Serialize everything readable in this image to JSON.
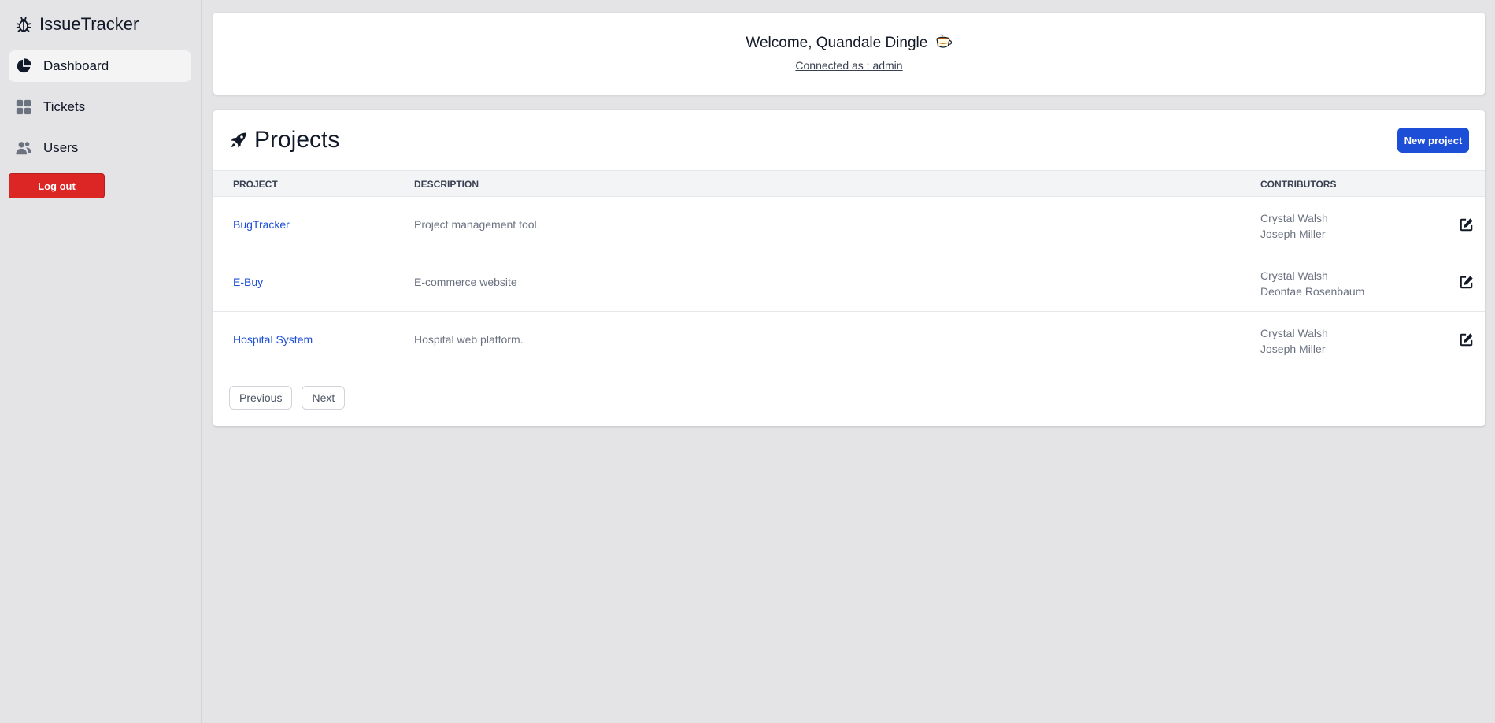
{
  "app": {
    "name": "IssueTracker",
    "logo_icon": "bug-icon"
  },
  "sidebar": {
    "items": [
      {
        "label": "Dashboard",
        "icon": "pie-chart-icon",
        "active": true
      },
      {
        "label": "Tickets",
        "icon": "grid-icon",
        "active": false
      },
      {
        "label": "Users",
        "icon": "users-icon",
        "active": false
      }
    ],
    "logout_label": "Log out"
  },
  "welcome": {
    "title": "Welcome, Quandale Dingle",
    "emoji_icon": "tea-cup-icon",
    "connected_as": "Connected as : admin"
  },
  "projects": {
    "title": "Projects",
    "title_icon": "rocket-icon",
    "new_button": "New project",
    "columns": [
      "PROJECT",
      "DESCRIPTION",
      "CONTRIBUTORS"
    ],
    "rows": [
      {
        "name": "BugTracker",
        "description": "Project management tool.",
        "contributors": [
          "Crystal Walsh",
          "Joseph Miller"
        ]
      },
      {
        "name": "E-Buy",
        "description": "E-commerce website",
        "contributors": [
          "Crystal Walsh",
          "Deontae Rosenbaum"
        ]
      },
      {
        "name": "Hospital System",
        "description": "Hospital web platform.",
        "contributors": [
          "Crystal Walsh",
          "Joseph Miller"
        ]
      }
    ],
    "pagination": {
      "previous": "Previous",
      "next": "Next"
    }
  },
  "colors": {
    "primary": "#1d4ed8",
    "danger": "#dc2626",
    "background": "#e4e4e7"
  }
}
